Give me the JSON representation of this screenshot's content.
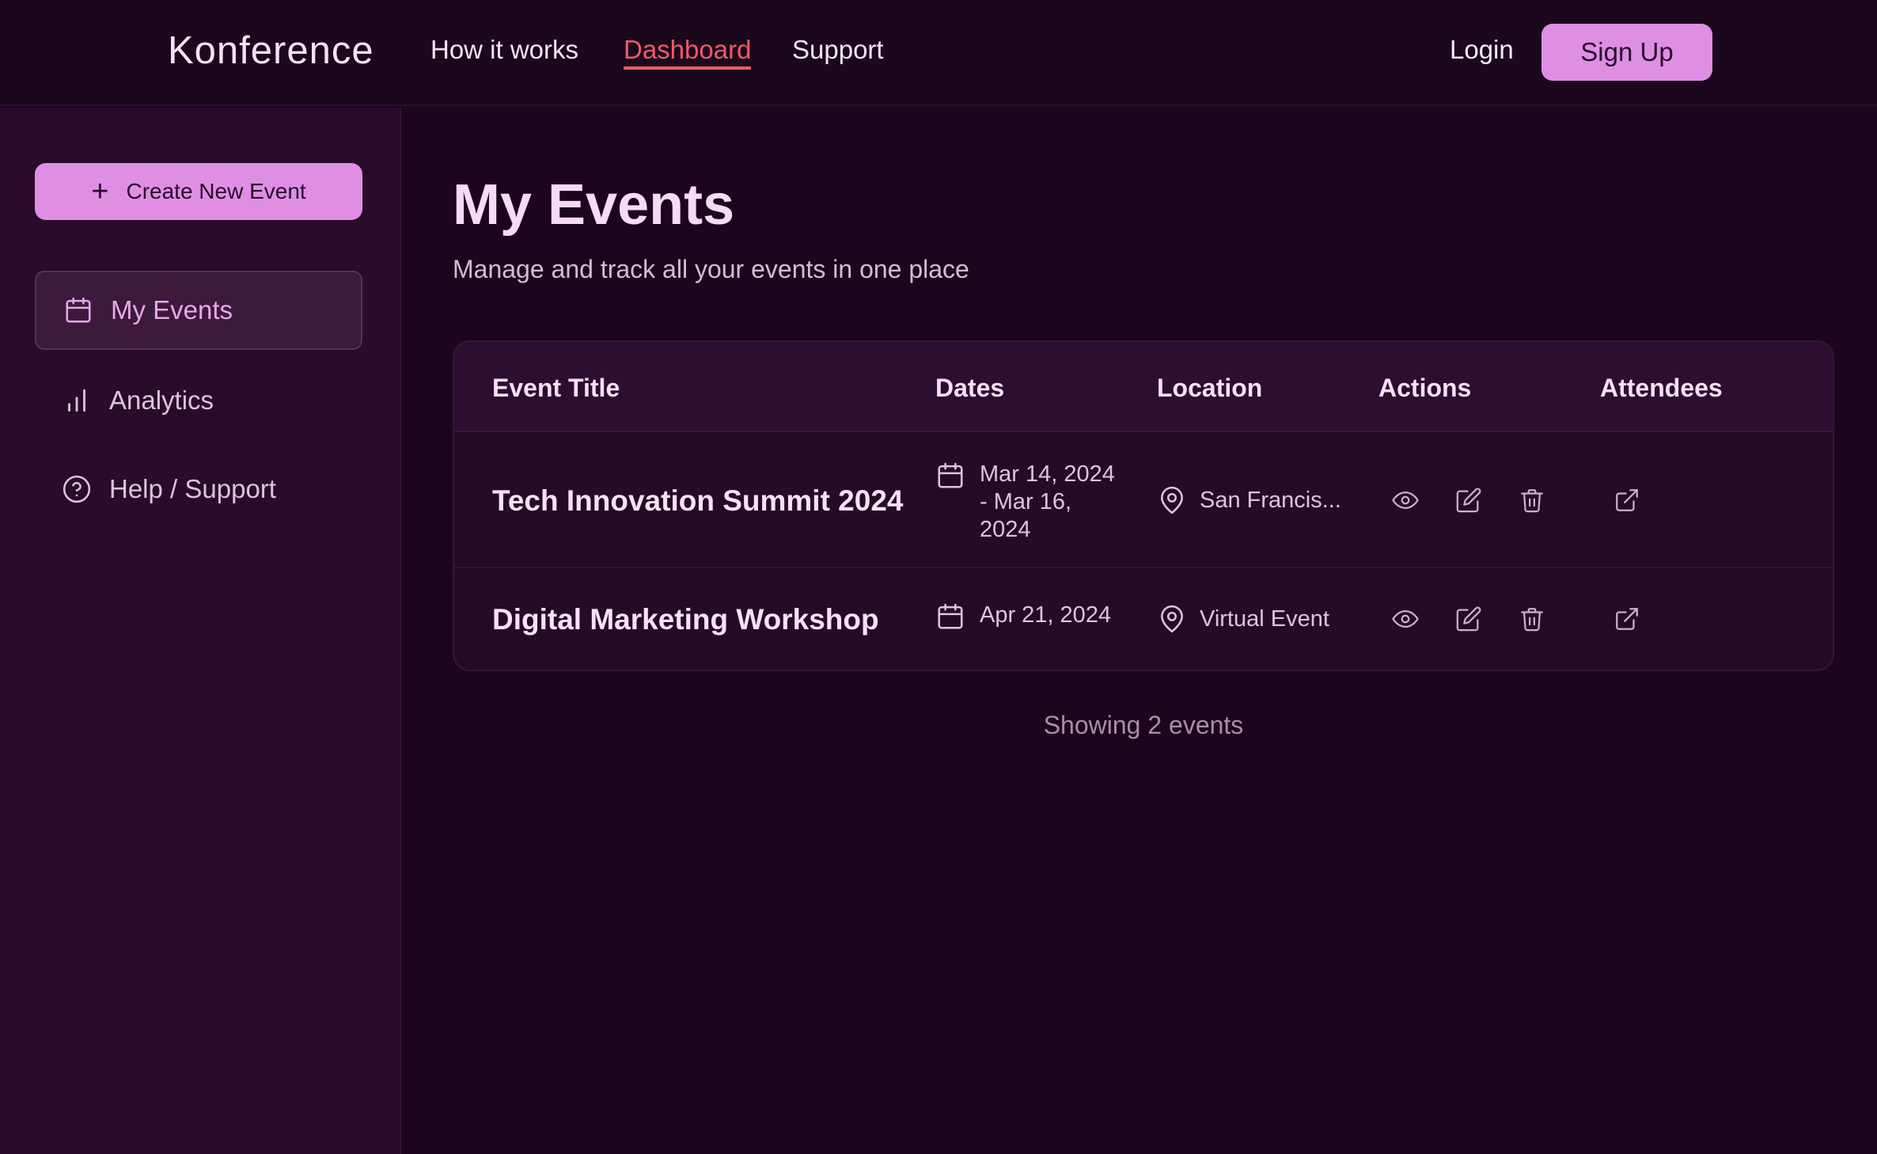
{
  "nav": {
    "logo": "Konference",
    "links": [
      "How it works",
      "Dashboard",
      "Support"
    ],
    "active": "Dashboard",
    "login": "Login",
    "signup": "Sign Up"
  },
  "sidebar": {
    "create_button": "Create New Event",
    "items": [
      {
        "label": "My Events",
        "icon": "calendar-icon",
        "active": true
      },
      {
        "label": "Analytics",
        "icon": "bar-chart-icon",
        "active": false
      },
      {
        "label": "Help / Support",
        "icon": "help-circle-icon",
        "active": false
      }
    ]
  },
  "main": {
    "title": "My Events",
    "subtitle": "Manage and track all your events in one place",
    "table": {
      "headers": [
        "Event Title",
        "Dates",
        "Location",
        "Actions",
        "Attendees"
      ],
      "rows": [
        {
          "title": "Tech Innovation Summit 2024",
          "dates": "Mar 14, 2024 - Mar 16, 2024",
          "location": "San Francis..."
        },
        {
          "title": "Digital Marketing Workshop",
          "dates": "Apr 21, 2024",
          "location": "Virtual Event"
        }
      ]
    },
    "footer": "Showing 2 events"
  },
  "colors": {
    "background": "#1d061d",
    "sidebar": "#2a0b2b",
    "accent": "#de8fe4",
    "active_link": "#ef5a6a"
  }
}
